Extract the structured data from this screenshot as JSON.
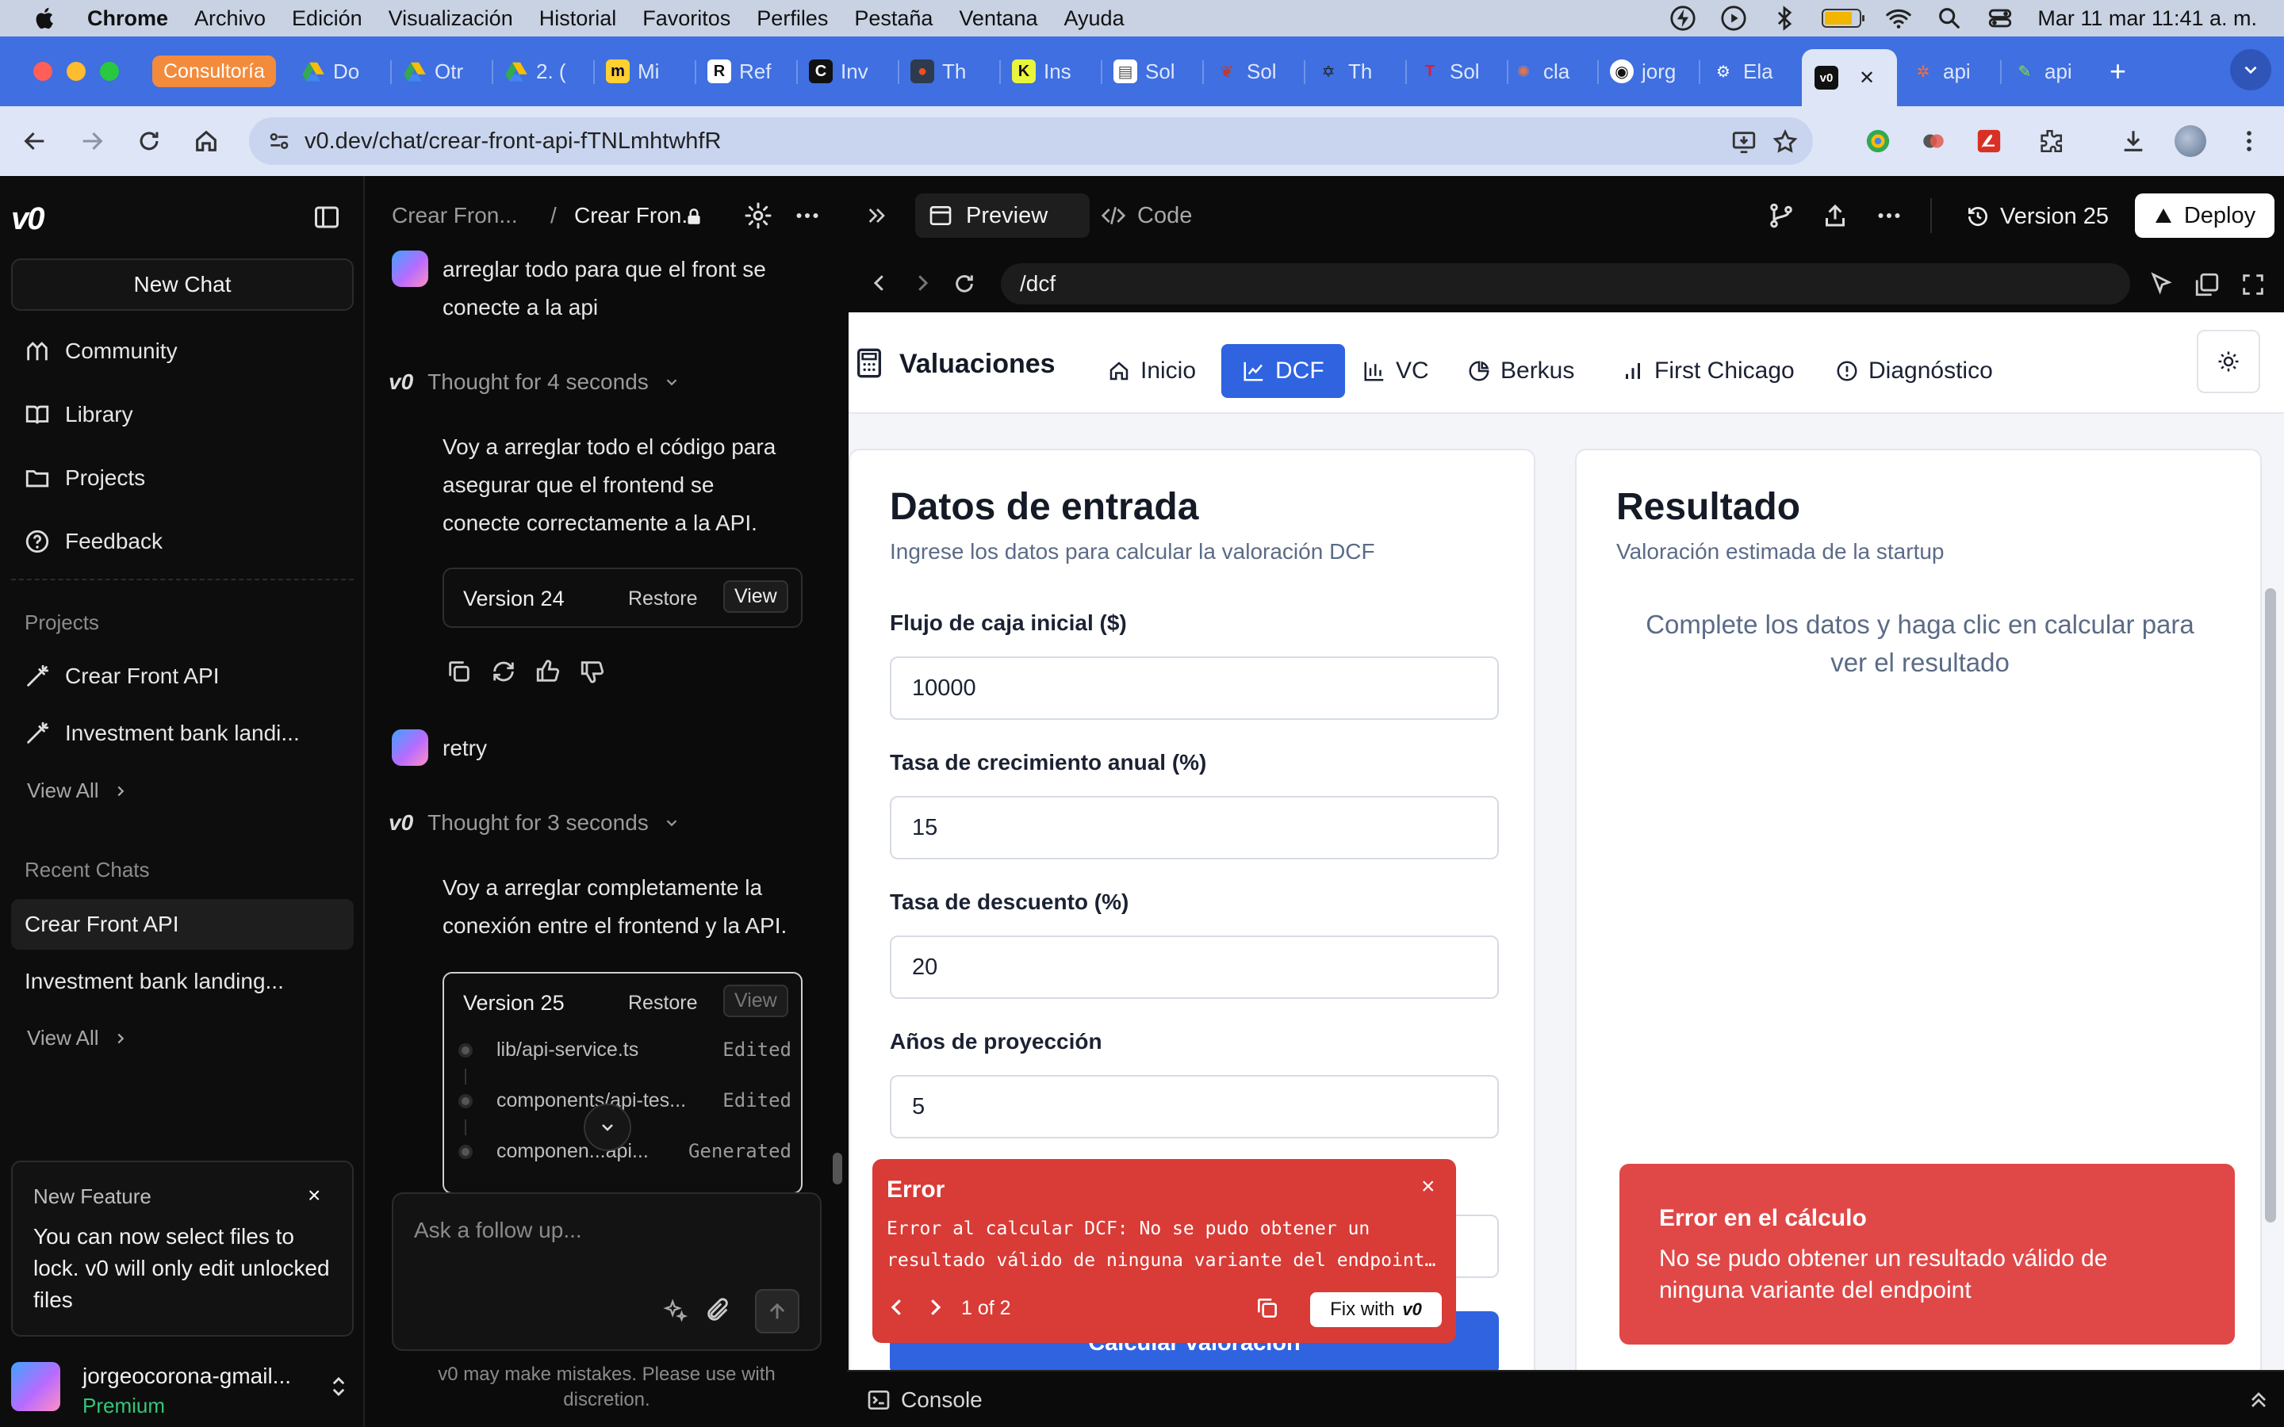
{
  "menubar": {
    "app": "Chrome",
    "items": [
      "Archivo",
      "Edición",
      "Visualización",
      "Historial",
      "Favoritos",
      "Perfiles",
      "Pestaña",
      "Ventana",
      "Ayuda"
    ],
    "datetime": "Mar 11 mar  11:41 a. m."
  },
  "tabs": {
    "group_label": "Consultoría",
    "items": [
      "Do",
      "Otr",
      "2. (",
      "Mi",
      "Ref",
      "Inv",
      "Th",
      "Ins",
      "Sol",
      "Sol",
      "Th",
      "Sol",
      "cla",
      "jorg",
      "Ela",
      "",
      "api",
      "api"
    ],
    "close": "✕",
    "new_tab": "+"
  },
  "address": {
    "url": "v0.dev/chat/crear-front-api-fTNLmhtwhfR"
  },
  "sidebar": {
    "new_chat": "New Chat",
    "nav": [
      "Community",
      "Library",
      "Projects",
      "Feedback"
    ],
    "projects_label": "Projects",
    "projects": [
      "Crear Front API",
      "Investment bank landi..."
    ],
    "view_all": "View All",
    "recent_label": "Recent Chats",
    "recent": [
      "Crear Front API",
      "Investment bank landing..."
    ],
    "feature_title": "New Feature",
    "feature_text": "You can now select files to lock. v0 will only edit unlocked files",
    "user_name": "jorgeocorona-gmail...",
    "user_plan": "Premium"
  },
  "chat": {
    "breadcrumb_1": "Crear Fron...",
    "breadcrumb_sep": "/",
    "breadcrumb_2": "Crear Fron...",
    "user_msg_1a": "arreglar todo para que el front se",
    "user_msg_1b": "conecte a la api",
    "thought_1": "Thought for 4 seconds",
    "reply_1a": "Voy a arreglar todo el código para",
    "reply_1b": "asegurar que el frontend se",
    "reply_1c": "conecte correctamente a la API.",
    "v24_label": "Version 24",
    "restore": "Restore",
    "view": "View",
    "user_msg_2": "retry",
    "thought_2": "Thought for 3 seconds",
    "reply_2a": "Voy a arreglar completamente la",
    "reply_2b": "conexión entre el frontend y la API.",
    "v25_label": "Version 25",
    "files": [
      {
        "name": "lib/api-service.ts",
        "status": "Edited"
      },
      {
        "name": "components/api-tes...",
        "status": "Edited"
      },
      {
        "name": "componen...api...",
        "status": "Generated"
      }
    ],
    "input_placeholder": "Ask a follow up...",
    "disclaimer_1": "v0 may make mistakes. Please use with",
    "disclaimer_2": "discretion."
  },
  "preview": {
    "tab_preview": "Preview",
    "tab_code": "Code",
    "version": "Version 25",
    "deploy": "Deploy",
    "path": "/dcf",
    "console": "Console"
  },
  "site": {
    "brand": "Valuaciones",
    "nav": [
      "Inicio",
      "DCF",
      "VC",
      "Berkus",
      "First Chicago",
      "Diagnóstico"
    ],
    "form_title": "Datos de entrada",
    "form_sub": "Ingrese los datos para calcular la valoración DCF",
    "fields": [
      {
        "label": "Flujo de caja inicial ($)",
        "value": "10000"
      },
      {
        "label": "Tasa de crecimiento anual (%)",
        "value": "15"
      },
      {
        "label": "Tasa de descuento (%)",
        "value": "20"
      },
      {
        "label": "Años de proyección",
        "value": "5"
      }
    ],
    "submit": "Calcular valoración",
    "result_title": "Resultado",
    "result_sub": "Valoración estimada de la startup",
    "result_placeholder_1": "Complete los datos y haga clic en calcular para",
    "result_placeholder_2": "ver el resultado",
    "error_toast_title": "Error en el cálculo",
    "error_toast_text_1": "No se pudo obtener un resultado válido de",
    "error_toast_text_2": "ninguna variante del endpoint"
  },
  "error_overlay": {
    "title": "Error",
    "line_1": "Error al calcular DCF: No se pudo obtener un",
    "line_2": "resultado válido de ninguna variante del endpoint…",
    "pager": "1 of 2",
    "fix": "Fix with"
  },
  "colors": {
    "accent": "#2f63e0",
    "error": "#d93b36",
    "tabstrip": "#3f6fe0",
    "group": "#f28b3c"
  }
}
